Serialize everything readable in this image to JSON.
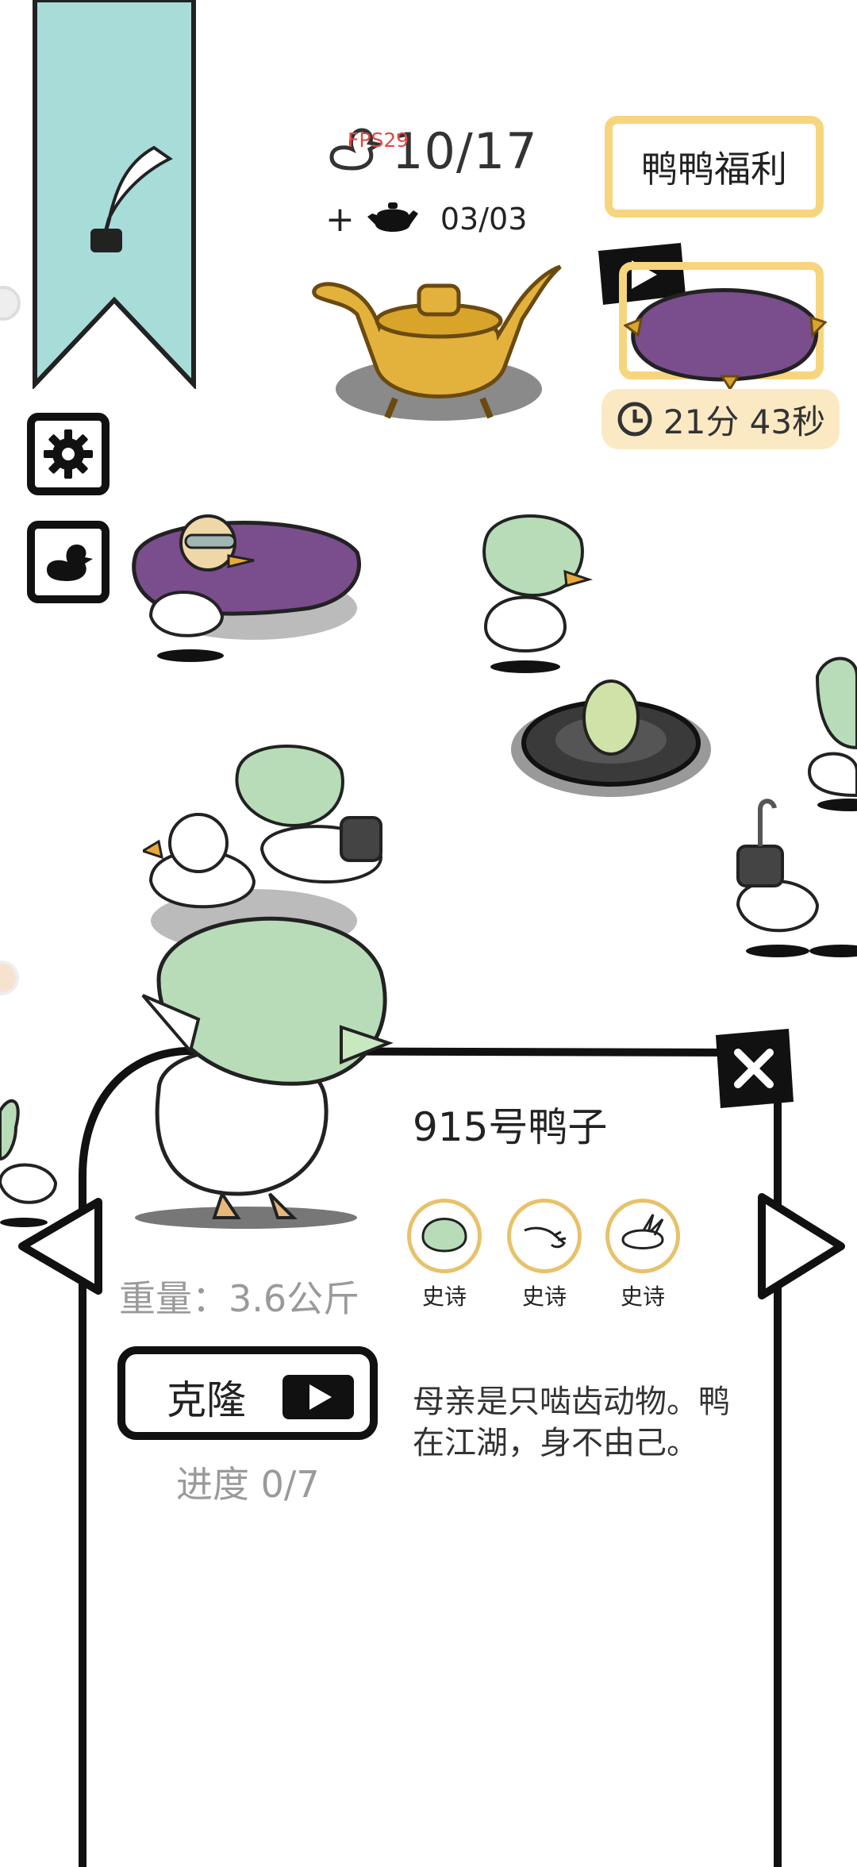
{
  "hud": {
    "fps": "FPS29",
    "duck_count": "10/17",
    "pot_plus": "+",
    "pot_count": "03/03",
    "welfare_label": "鸭鸭福利",
    "timer": "21分 43秒"
  },
  "duck_card": {
    "title": "915号鸭子",
    "traits": [
      {
        "label": "史诗",
        "icon": "green-hair-icon"
      },
      {
        "label": "史诗",
        "icon": "hand-icon"
      },
      {
        "label": "史诗",
        "icon": "wings-icon"
      }
    ],
    "weight": "重量：3.6公斤",
    "clone_label": "克隆",
    "progress": "进度 0/7",
    "description": "母亲是只啮齿动物。鸭在江湖，身不由己。"
  },
  "colors": {
    "banner": "#a8dcd9",
    "accent_gold": "#f7d57e",
    "timer_bg": "#fbe9c4",
    "cushion_purple": "#7a4d8c",
    "teapot_gold": "#e3b23c",
    "hair_green": "#b8dcb8",
    "fps_red": "#e34848"
  },
  "icons": [
    "quill-ink-icon",
    "gear-icon",
    "duck-icon",
    "duck-outline-icon",
    "teapot-icon",
    "play-icon",
    "clock-icon",
    "close-icon",
    "left-arrow-icon",
    "right-arrow-icon"
  ]
}
